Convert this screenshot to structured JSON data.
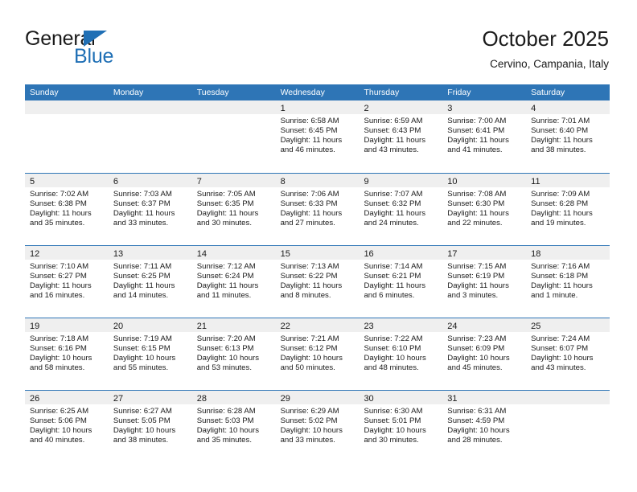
{
  "brand": {
    "name_top": "General",
    "name_bottom": "Blue",
    "color_blue": "#1f6fb5"
  },
  "header": {
    "title": "October 2025",
    "subtitle": "Cervino, Campania, Italy"
  },
  "theme": {
    "header_row_bg": "#2e75b6",
    "day_band_bg": "#efefef",
    "text": "#1a1a1a"
  },
  "weekdays": [
    "Sunday",
    "Monday",
    "Tuesday",
    "Wednesday",
    "Thursday",
    "Friday",
    "Saturday"
  ],
  "weeks": [
    [
      {
        "day": "",
        "empty": true,
        "lines": []
      },
      {
        "day": "",
        "empty": true,
        "lines": []
      },
      {
        "day": "",
        "empty": true,
        "lines": []
      },
      {
        "day": "1",
        "empty": false,
        "lines": [
          "Sunrise: 6:58 AM",
          "Sunset: 6:45 PM",
          "Daylight: 11 hours",
          "and 46 minutes."
        ]
      },
      {
        "day": "2",
        "empty": false,
        "lines": [
          "Sunrise: 6:59 AM",
          "Sunset: 6:43 PM",
          "Daylight: 11 hours",
          "and 43 minutes."
        ]
      },
      {
        "day": "3",
        "empty": false,
        "lines": [
          "Sunrise: 7:00 AM",
          "Sunset: 6:41 PM",
          "Daylight: 11 hours",
          "and 41 minutes."
        ]
      },
      {
        "day": "4",
        "empty": false,
        "lines": [
          "Sunrise: 7:01 AM",
          "Sunset: 6:40 PM",
          "Daylight: 11 hours",
          "and 38 minutes."
        ]
      }
    ],
    [
      {
        "day": "5",
        "empty": false,
        "lines": [
          "Sunrise: 7:02 AM",
          "Sunset: 6:38 PM",
          "Daylight: 11 hours",
          "and 35 minutes."
        ]
      },
      {
        "day": "6",
        "empty": false,
        "lines": [
          "Sunrise: 7:03 AM",
          "Sunset: 6:37 PM",
          "Daylight: 11 hours",
          "and 33 minutes."
        ]
      },
      {
        "day": "7",
        "empty": false,
        "lines": [
          "Sunrise: 7:05 AM",
          "Sunset: 6:35 PM",
          "Daylight: 11 hours",
          "and 30 minutes."
        ]
      },
      {
        "day": "8",
        "empty": false,
        "lines": [
          "Sunrise: 7:06 AM",
          "Sunset: 6:33 PM",
          "Daylight: 11 hours",
          "and 27 minutes."
        ]
      },
      {
        "day": "9",
        "empty": false,
        "lines": [
          "Sunrise: 7:07 AM",
          "Sunset: 6:32 PM",
          "Daylight: 11 hours",
          "and 24 minutes."
        ]
      },
      {
        "day": "10",
        "empty": false,
        "lines": [
          "Sunrise: 7:08 AM",
          "Sunset: 6:30 PM",
          "Daylight: 11 hours",
          "and 22 minutes."
        ]
      },
      {
        "day": "11",
        "empty": false,
        "lines": [
          "Sunrise: 7:09 AM",
          "Sunset: 6:28 PM",
          "Daylight: 11 hours",
          "and 19 minutes."
        ]
      }
    ],
    [
      {
        "day": "12",
        "empty": false,
        "lines": [
          "Sunrise: 7:10 AM",
          "Sunset: 6:27 PM",
          "Daylight: 11 hours",
          "and 16 minutes."
        ]
      },
      {
        "day": "13",
        "empty": false,
        "lines": [
          "Sunrise: 7:11 AM",
          "Sunset: 6:25 PM",
          "Daylight: 11 hours",
          "and 14 minutes."
        ]
      },
      {
        "day": "14",
        "empty": false,
        "lines": [
          "Sunrise: 7:12 AM",
          "Sunset: 6:24 PM",
          "Daylight: 11 hours",
          "and 11 minutes."
        ]
      },
      {
        "day": "15",
        "empty": false,
        "lines": [
          "Sunrise: 7:13 AM",
          "Sunset: 6:22 PM",
          "Daylight: 11 hours",
          "and 8 minutes."
        ]
      },
      {
        "day": "16",
        "empty": false,
        "lines": [
          "Sunrise: 7:14 AM",
          "Sunset: 6:21 PM",
          "Daylight: 11 hours",
          "and 6 minutes."
        ]
      },
      {
        "day": "17",
        "empty": false,
        "lines": [
          "Sunrise: 7:15 AM",
          "Sunset: 6:19 PM",
          "Daylight: 11 hours",
          "and 3 minutes."
        ]
      },
      {
        "day": "18",
        "empty": false,
        "lines": [
          "Sunrise: 7:16 AM",
          "Sunset: 6:18 PM",
          "Daylight: 11 hours",
          "and 1 minute."
        ]
      }
    ],
    [
      {
        "day": "19",
        "empty": false,
        "lines": [
          "Sunrise: 7:18 AM",
          "Sunset: 6:16 PM",
          "Daylight: 10 hours",
          "and 58 minutes."
        ]
      },
      {
        "day": "20",
        "empty": false,
        "lines": [
          "Sunrise: 7:19 AM",
          "Sunset: 6:15 PM",
          "Daylight: 10 hours",
          "and 55 minutes."
        ]
      },
      {
        "day": "21",
        "empty": false,
        "lines": [
          "Sunrise: 7:20 AM",
          "Sunset: 6:13 PM",
          "Daylight: 10 hours",
          "and 53 minutes."
        ]
      },
      {
        "day": "22",
        "empty": false,
        "lines": [
          "Sunrise: 7:21 AM",
          "Sunset: 6:12 PM",
          "Daylight: 10 hours",
          "and 50 minutes."
        ]
      },
      {
        "day": "23",
        "empty": false,
        "lines": [
          "Sunrise: 7:22 AM",
          "Sunset: 6:10 PM",
          "Daylight: 10 hours",
          "and 48 minutes."
        ]
      },
      {
        "day": "24",
        "empty": false,
        "lines": [
          "Sunrise: 7:23 AM",
          "Sunset: 6:09 PM",
          "Daylight: 10 hours",
          "and 45 minutes."
        ]
      },
      {
        "day": "25",
        "empty": false,
        "lines": [
          "Sunrise: 7:24 AM",
          "Sunset: 6:07 PM",
          "Daylight: 10 hours",
          "and 43 minutes."
        ]
      }
    ],
    [
      {
        "day": "26",
        "empty": false,
        "lines": [
          "Sunrise: 6:25 AM",
          "Sunset: 5:06 PM",
          "Daylight: 10 hours",
          "and 40 minutes."
        ]
      },
      {
        "day": "27",
        "empty": false,
        "lines": [
          "Sunrise: 6:27 AM",
          "Sunset: 5:05 PM",
          "Daylight: 10 hours",
          "and 38 minutes."
        ]
      },
      {
        "day": "28",
        "empty": false,
        "lines": [
          "Sunrise: 6:28 AM",
          "Sunset: 5:03 PM",
          "Daylight: 10 hours",
          "and 35 minutes."
        ]
      },
      {
        "day": "29",
        "empty": false,
        "lines": [
          "Sunrise: 6:29 AM",
          "Sunset: 5:02 PM",
          "Daylight: 10 hours",
          "and 33 minutes."
        ]
      },
      {
        "day": "30",
        "empty": false,
        "lines": [
          "Sunrise: 6:30 AM",
          "Sunset: 5:01 PM",
          "Daylight: 10 hours",
          "and 30 minutes."
        ]
      },
      {
        "day": "31",
        "empty": false,
        "lines": [
          "Sunrise: 6:31 AM",
          "Sunset: 4:59 PM",
          "Daylight: 10 hours",
          "and 28 minutes."
        ]
      },
      {
        "day": "",
        "empty": true,
        "lines": []
      }
    ]
  ]
}
